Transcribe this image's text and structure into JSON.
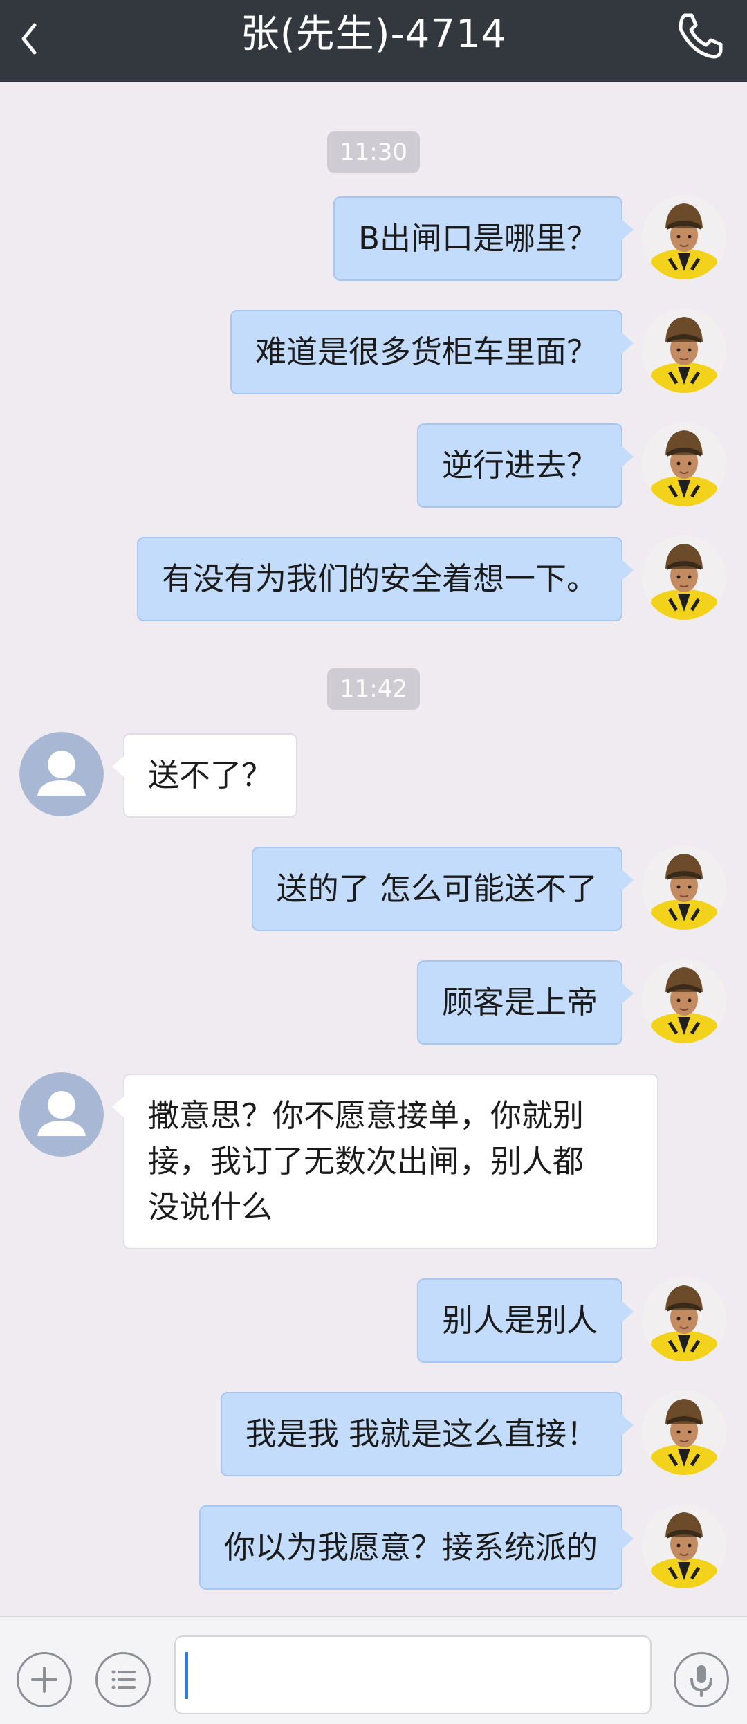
{
  "header": {
    "title": "张(先生)-4714",
    "back_icon": "chevron-left-icon",
    "call_icon": "phone-icon"
  },
  "chat": {
    "timestamps": [
      "11:30",
      "11:42"
    ],
    "messages": [
      {
        "from": "me",
        "text": "B出闸口是哪里？"
      },
      {
        "from": "me",
        "text": "难道是很多货柜车里面？"
      },
      {
        "from": "me",
        "text": "逆行进去？"
      },
      {
        "from": "me",
        "text": "有没有为我们的安全着想一下。"
      },
      {
        "from": "other",
        "text": "送不了？"
      },
      {
        "from": "me",
        "text": "送的了 怎么可能送不了"
      },
      {
        "from": "me",
        "text": "顾客是上帝"
      },
      {
        "from": "other",
        "text": "撒意思？你不愿意接单，你就别\n接，我订了无数次出闸，别人都\n没说什么"
      },
      {
        "from": "me",
        "text": "别人是别人"
      },
      {
        "from": "me",
        "text": "我是我 我就是这么直接！"
      },
      {
        "from": "me",
        "text": "你以为我愿意？接系统派的"
      }
    ]
  },
  "input_bar": {
    "plus_icon": "plus-icon",
    "menu_icon": "list-icon",
    "message_value": "",
    "mic_icon": "microphone-icon"
  },
  "colors": {
    "header_bg": "#33383f",
    "chat_bg": "#efebf1",
    "my_bubble": "#c4dcfb",
    "other_bubble": "#ffffff",
    "helmet_yellow": "#f2d21a"
  }
}
